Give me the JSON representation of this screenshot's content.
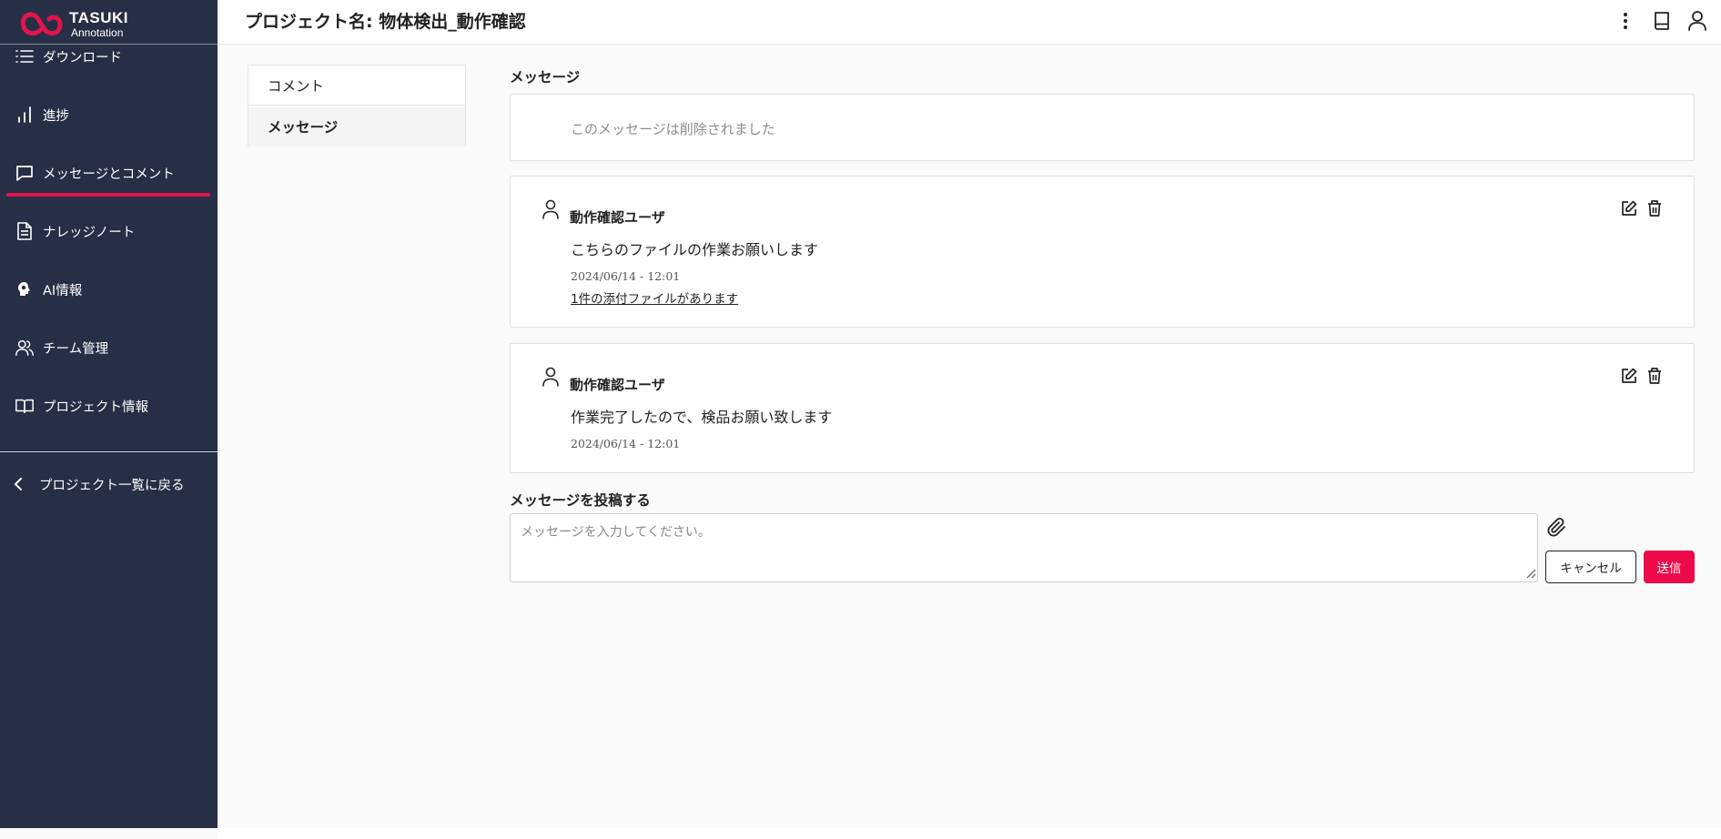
{
  "brand": {
    "line1": "TASUKI",
    "line2": "Annotation",
    "accent_color": "#e0154c"
  },
  "sidebar": {
    "items": [
      {
        "label": "ダウンロード",
        "icon": "list-icon"
      },
      {
        "label": "進捗",
        "icon": "bar-chart-icon"
      },
      {
        "label": "メッセージとコメント",
        "icon": "message-square-icon",
        "active": true
      },
      {
        "label": "ナレッジノート",
        "icon": "document-icon"
      },
      {
        "label": "AI情報",
        "icon": "ai-head-icon"
      },
      {
        "label": "チーム管理",
        "icon": "users-icon"
      },
      {
        "label": "プロジェクト情報",
        "icon": "open-book-icon"
      }
    ],
    "back_label": "プロジェクト一覧に戻る"
  },
  "header": {
    "title": "プロジェクト名: 物体検出_動作確認",
    "icons": [
      "more-vertical-icon",
      "book-icon",
      "user-icon"
    ]
  },
  "tabs": [
    {
      "label": "コメント",
      "active": false
    },
    {
      "label": "メッセージ",
      "active": true
    }
  ],
  "messages_section": {
    "title": "メッセージ",
    "deleted_text": "このメッセージは削除されました",
    "messages": [
      {
        "user": "動作確認ユーザ",
        "text": "こちらのファイルの作業お願いします",
        "time": "2024/06/14 - 12:01",
        "attachment": "1件の添付ファイルがあります"
      },
      {
        "user": "動作確認ユーザ",
        "text": "作業完了したので、検品お願い致します",
        "time": "2024/06/14 - 12:01"
      }
    ]
  },
  "compose": {
    "title": "メッセージを投稿する",
    "placeholder": "メッセージを入力してください。",
    "value": "",
    "cancel_label": "キャンセル",
    "send_label": "送信",
    "send_color": "#ec0a4b"
  }
}
